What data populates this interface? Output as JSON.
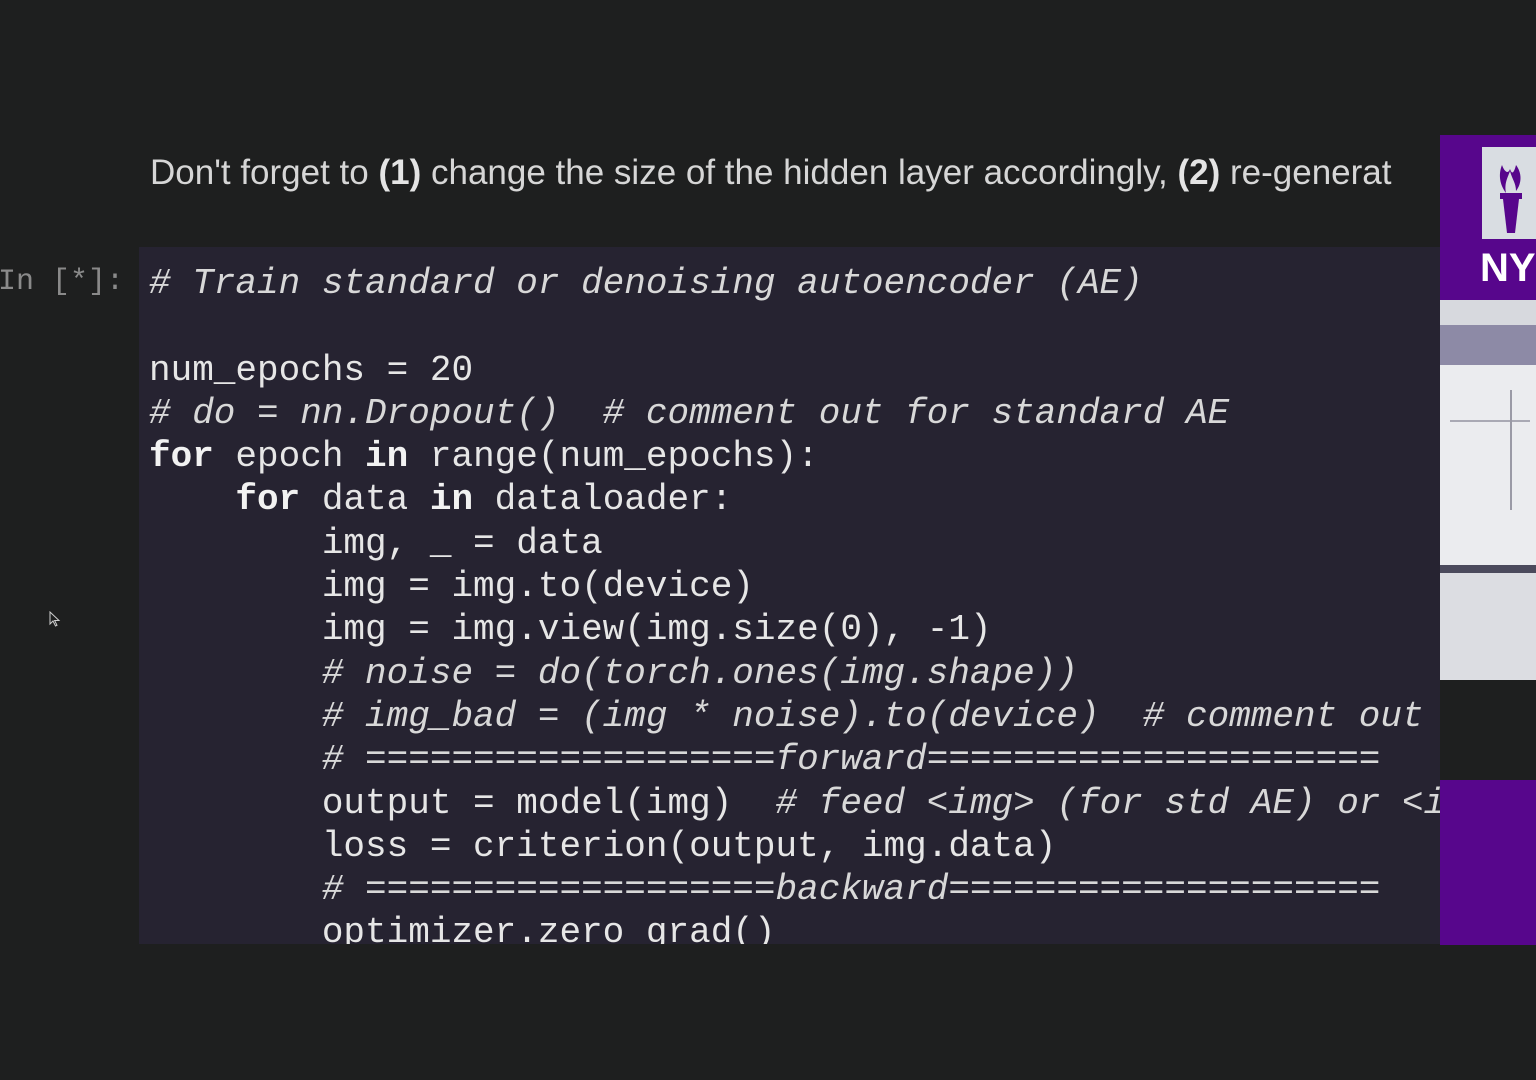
{
  "markdown": {
    "before_1": "Don't forget to ",
    "mark_1": "(1)",
    "mid_1": " change the size of the hidden layer accordingly, ",
    "mark_2": "(2)",
    "after_2": " re-generat"
  },
  "cell": {
    "prompt": "In [*]:",
    "lines": {
      "l1": {
        "comment": "# Train standard or denoising autoencoder (AE)"
      },
      "l2": {
        "text": ""
      },
      "l3": {
        "text": "num_epochs = 20"
      },
      "l4": {
        "comment": "# do = nn.Dropout()  # comment out for standard AE"
      },
      "l5": {
        "kw1": "for",
        "a": " epoch ",
        "kw2": "in",
        "b": " range(num_epochs):"
      },
      "l6": {
        "indent": "    ",
        "kw1": "for",
        "a": " data ",
        "kw2": "in",
        "b": " dataloader:"
      },
      "l7": {
        "text": "        img, _ = data"
      },
      "l8": {
        "text": "        img = img.to(device)"
      },
      "l9": {
        "text": "        img = img.view(img.size(0), -1)"
      },
      "l10": {
        "indent": "        ",
        "comment": "# noise = do(torch.ones(img.shape))"
      },
      "l11": {
        "indent": "        ",
        "comment": "# img_bad = (img * noise).to(device)  # comment out"
      },
      "l12": {
        "indent": "        ",
        "comment": "# ===================forward====================="
      },
      "l13": {
        "code": "        output = model(img)  ",
        "comment": "# feed <img> (for std AE) or <i"
      },
      "l14": {
        "text": "        loss = criterion(output, img.data)"
      },
      "l15": {
        "indent": "        ",
        "comment": "# ===================backward===================="
      },
      "l16": {
        "text": "        optimizer.zero_grad()"
      }
    }
  },
  "sidebar": {
    "logo_text": "NY",
    "brand_color": "#57068c"
  },
  "icons": {
    "cursor": "mouse-pointer-icon",
    "torch": "nyu-torch-logo-icon"
  }
}
